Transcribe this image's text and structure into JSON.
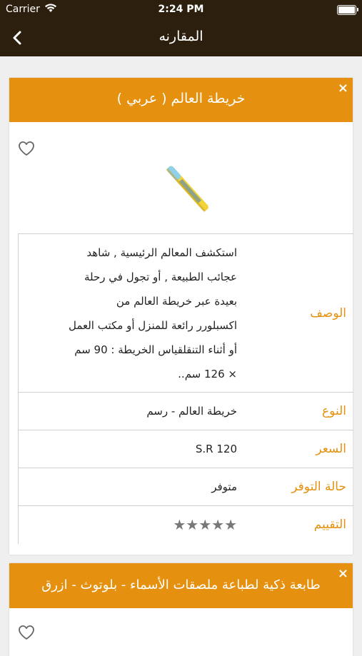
{
  "status_bar": {
    "carrier": "Carrier",
    "time": "2:24 PM"
  },
  "nav": {
    "title": "المقارنه",
    "back_icon": "chevron-left-icon"
  },
  "colors": {
    "accent": "#e5910f",
    "bar": "#2c1f0e",
    "background": "#efefef"
  },
  "products": [
    {
      "title": "خريطة العالم ( عربي )",
      "close": "×",
      "rows": {
        "description": {
          "label": "الوصف",
          "lines": [
            "استكشف المعالم الرئيسية , شاهد",
            "عجائب الطبيعة , أو تجول في رحلة",
            "بعيدة عبر خريطة العالم من",
            "اكسبلورر رائعة للمنزل أو مكتب العمل",
            "أو أثناء التنقلقياس الخريطة : 90 سم",
            "× 126 سم.."
          ]
        },
        "type": {
          "label": "النوع",
          "value": "خريطة العالم - رسم"
        },
        "price": {
          "label": "السعر",
          "value": "S.R 120"
        },
        "availability": {
          "label": "حالة التوفر",
          "value": "متوفر"
        },
        "rating": {
          "label": "التقييم",
          "value": 0,
          "max": 5,
          "stars": "★★★★★"
        }
      }
    },
    {
      "title": "طابعة ذكية لطباعة ملصقات الأسماء - بلوتوث - ازرق",
      "close": "×"
    }
  ]
}
